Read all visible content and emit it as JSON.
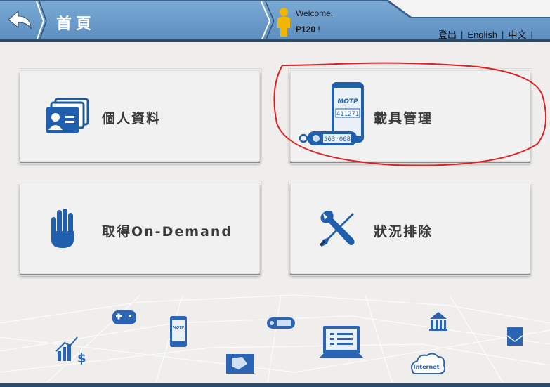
{
  "header": {
    "title": "首頁",
    "welcome": "Welcome,",
    "user_id": "P120",
    "user_suffix": "!",
    "links": {
      "logout": "登出",
      "english": "English",
      "chinese": "中文"
    },
    "separator": "|",
    "colors": {
      "bar": "#6f9fcb",
      "bar_dark": "#2e527a",
      "avatar": "#f3b600"
    }
  },
  "menu": {
    "personal_info": {
      "label": "個人資料",
      "icon": "id-cards-icon"
    },
    "device_management": {
      "label": "載具管理",
      "icon": "motp-device-icon",
      "phone_brand": "MOTP",
      "phone_code": "411271",
      "token_code": "563 068"
    },
    "get_on_demand": {
      "label": "取得On-Demand",
      "icon": "hand-stop-icon"
    },
    "troubleshooting": {
      "label": "狀況排除",
      "icon": "tools-icon"
    }
  },
  "decor": {
    "internet_label": "Internet",
    "brand": "MOTP",
    "accent": "#2b64b3"
  }
}
